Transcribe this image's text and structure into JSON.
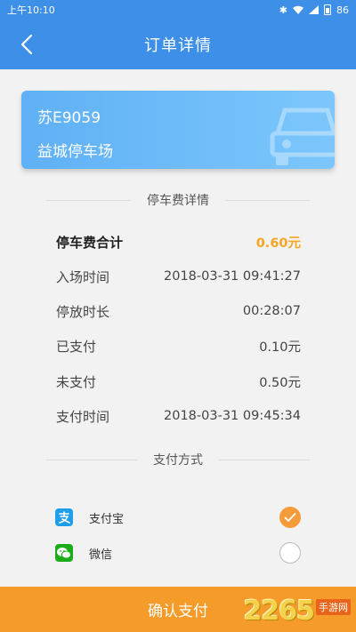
{
  "status_bar": {
    "time": "上午10:10",
    "battery": "86"
  },
  "nav": {
    "title": "订单详情"
  },
  "card": {
    "plate": "苏E9059",
    "lot": "益城停车场"
  },
  "fee_section": {
    "title": "停车费详情",
    "rows": [
      {
        "key": "停车费合计",
        "value": "0.60元"
      },
      {
        "key": "入场时间",
        "value": "2018-03-31 09:41:27"
      },
      {
        "key": "停放时长",
        "value": "00:28:07"
      },
      {
        "key": "已支付",
        "value": "0.10元"
      },
      {
        "key": "未支付",
        "value": "0.50元"
      },
      {
        "key": "支付时间",
        "value": "2018-03-31 09:45:34"
      }
    ]
  },
  "payment_section": {
    "title": "支付方式",
    "options": [
      {
        "label": "支付宝",
        "icon": "alipay-icon",
        "selected": true
      },
      {
        "label": "微信",
        "icon": "wechat-icon",
        "selected": false
      }
    ]
  },
  "confirm": {
    "label": "确认支付"
  },
  "watermark": {
    "number": "2265",
    "suffix": "手游网"
  },
  "colors": {
    "primary": "#3d8fe8",
    "accent": "#f59b2a",
    "total": "#f5a623"
  }
}
